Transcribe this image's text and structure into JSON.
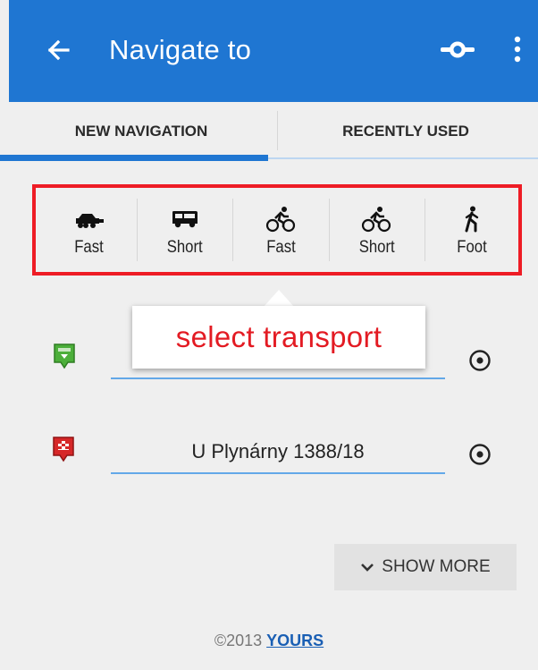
{
  "appbar": {
    "title": "Navigate to",
    "icons": [
      "back-arrow-icon",
      "waypoint-icon",
      "more-vert-icon"
    ],
    "color": "#1f76d2"
  },
  "tabs": [
    {
      "label": "NEW NAVIGATION",
      "active": true
    },
    {
      "label": "RECENTLY USED",
      "active": false
    }
  ],
  "transport": {
    "items": [
      {
        "icon": "car-icon",
        "label": "Fast"
      },
      {
        "icon": "bus-icon",
        "label": "Short"
      },
      {
        "icon": "bicycle-icon",
        "label": "Fast"
      },
      {
        "icon": "bicycle-icon",
        "label": "Short"
      },
      {
        "icon": "walking-icon",
        "label": "Foot"
      }
    ],
    "highlight_color": "#ee1c25"
  },
  "callout": {
    "text": "select transport",
    "color": "#e31b23"
  },
  "route": {
    "start": {
      "value": "",
      "pin_icon": "start-pin-icon",
      "pin_color": "#4caf3a"
    },
    "end": {
      "value": "U Plynárny 1388/18",
      "pin_icon": "end-pin-icon",
      "pin_color": "#d62728"
    }
  },
  "show_more": {
    "label": "SHOW MORE",
    "icon": "chevron-down-icon"
  },
  "footer": {
    "copyright": "©2013 ",
    "link": "YOURS"
  }
}
